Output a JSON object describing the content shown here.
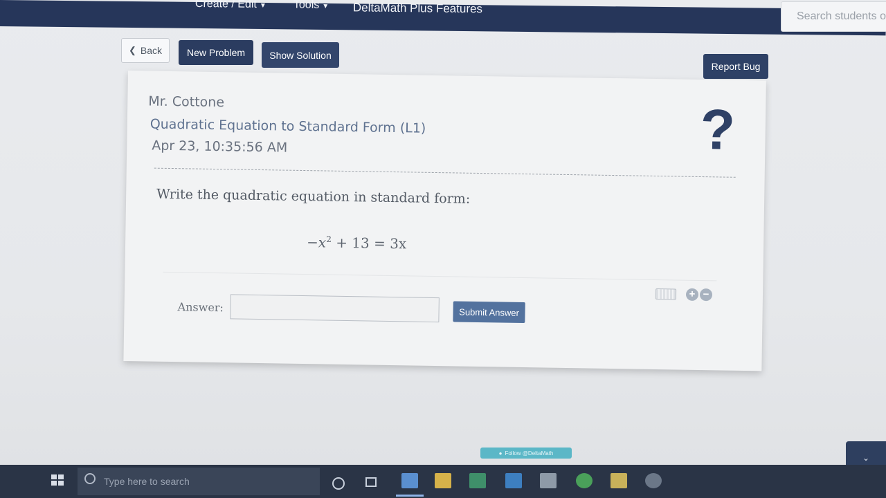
{
  "nav": {
    "create_edit": "Create / Edit",
    "tools": "Tools",
    "plus_features": "DeltaMath Plus Features",
    "search_placeholder": "Search students o"
  },
  "toolbar": {
    "back_label": "Back",
    "new_problem_label": "New Problem",
    "show_solution_label": "Show Solution",
    "report_bug_label": "Report Bug"
  },
  "problem": {
    "teacher": "Mr. Cottone",
    "assignment": "Quadratic Equation to Standard Form (L1)",
    "timestamp": "Apr 23, 10:35:56 AM",
    "help_symbol": "?",
    "prompt": "Write the quadratic equation in standard form:",
    "equation": {
      "lead": "−x",
      "exponent": "2",
      "rest": " + 13 = 3x"
    }
  },
  "answer": {
    "label": "Answer:",
    "value": "",
    "placeholder": "",
    "submit_label": "Submit Answer"
  },
  "footer": {
    "follow_badge": "Follow @DeltaMath"
  },
  "taskbar": {
    "search_placeholder": "Type here to search"
  },
  "colors": {
    "nav_bg": "#26365a",
    "primary_button": "#2b3c60",
    "submit_button": "#53729e",
    "follow_badge": "#5bb7c7"
  },
  "icons": {
    "back": "chevron-left-icon",
    "help": "question-mark-icon",
    "keyboard": "keyboard-icon",
    "zoom_in": "zoom-in-icon",
    "zoom_out": "zoom-out-icon",
    "start": "windows-start-icon",
    "search": "search-icon"
  }
}
